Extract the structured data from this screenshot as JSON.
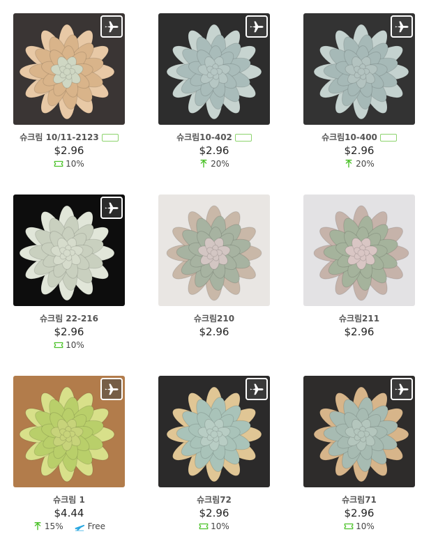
{
  "products": [
    {
      "name": "슈크림 10/11-2123",
      "tag": true,
      "price": "$2.96",
      "plane": true,
      "perks": [
        {
          "icon": "coupon-icon",
          "text": "10%"
        }
      ],
      "colors": {
        "bg": "#3a3534",
        "leaf": "#d9b48a",
        "edge": "#e8c9a6",
        "center": "#cfd7c3"
      }
    },
    {
      "name": "슈크림10-402",
      "tag": true,
      "price": "$2.96",
      "plane": true,
      "perks": [
        {
          "icon": "arrow-up-icon",
          "text": "20%"
        }
      ],
      "colors": {
        "bg": "#2d2d2d",
        "leaf": "#a9bcba",
        "edge": "#c7d4d0",
        "center": "#b6c7c4"
      }
    },
    {
      "name": "슈크림10-400",
      "tag": true,
      "price": "$2.96",
      "plane": true,
      "perks": [
        {
          "icon": "arrow-up-icon",
          "text": "20%"
        }
      ],
      "colors": {
        "bg": "#333333",
        "leaf": "#a6b9b7",
        "edge": "#c4d2cf",
        "center": "#b3c3c0"
      }
    },
    {
      "name": "슈크림 22-216",
      "tag": false,
      "price": "$2.96",
      "plane": true,
      "perks": [
        {
          "icon": "coupon-icon",
          "text": "10%"
        }
      ],
      "colors": {
        "bg": "#0d0d0d",
        "leaf": "#c9d0bf",
        "edge": "#e1e6d9",
        "center": "#d6dccc"
      }
    },
    {
      "name": "슈크림210",
      "tag": false,
      "price": "$2.96",
      "plane": false,
      "perks": [],
      "colors": {
        "bg": "#e9e6e3",
        "leaf": "#a7b3a1",
        "edge": "#c9b8a8",
        "center": "#d3c6c3"
      }
    },
    {
      "name": "슈크림211",
      "tag": false,
      "price": "$2.96",
      "plane": false,
      "perks": [],
      "colors": {
        "bg": "#e3e2e4",
        "leaf": "#a5b39c",
        "edge": "#c6b3aa",
        "center": "#d9c6c4"
      }
    },
    {
      "name": "슈크림 1",
      "tag": false,
      "price": "$4.44",
      "plane": true,
      "perks": [
        {
          "icon": "arrow-up-icon",
          "text": "15%"
        },
        {
          "icon": "plane-shipping-icon",
          "text": "Free"
        }
      ],
      "colors": {
        "bg": "#b27c4b",
        "leaf": "#b9cf6a",
        "edge": "#d8e08a",
        "center": "#c7d37a"
      }
    },
    {
      "name": "슈크림72",
      "tag": false,
      "price": "$2.96",
      "plane": true,
      "perks": [
        {
          "icon": "coupon-icon",
          "text": "10%"
        }
      ],
      "colors": {
        "bg": "#2b2a2a",
        "leaf": "#a9c3b9",
        "edge": "#e0c695",
        "center": "#b8cdc4"
      }
    },
    {
      "name": "슈크림71",
      "tag": false,
      "price": "$2.96",
      "plane": true,
      "perks": [
        {
          "icon": "coupon-icon",
          "text": "10%"
        }
      ],
      "colors": {
        "bg": "#2e2c2b",
        "leaf": "#a7bbb2",
        "edge": "#d7b58a",
        "center": "#b4c6bd"
      }
    }
  ],
  "colors": {
    "accent_green": "#4cc22a",
    "tag_border": "#8cd36d",
    "shipping_blue": "#2aa7e0"
  }
}
